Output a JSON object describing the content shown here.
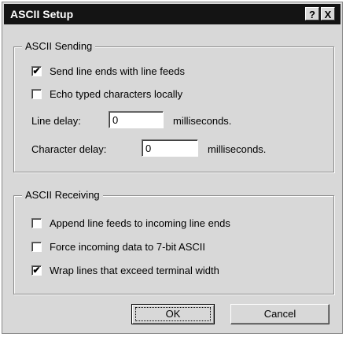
{
  "window": {
    "title": "ASCII Setup",
    "help_btn": "?",
    "close_btn": "X"
  },
  "sending": {
    "legend": "ASCII Sending",
    "send_line_ends": {
      "label": "Send line ends with line feeds",
      "checked": true
    },
    "echo_typed": {
      "label": "Echo typed characters locally",
      "checked": false
    },
    "line_delay": {
      "label": "Line delay:",
      "value": "0",
      "unit": "milliseconds."
    },
    "char_delay": {
      "label": "Character delay:",
      "value": "0",
      "unit": "milliseconds."
    }
  },
  "receiving": {
    "legend": "ASCII Receiving",
    "append_line_feeds": {
      "label": "Append line feeds to incoming line ends",
      "checked": false
    },
    "force_7bit": {
      "label": "Force incoming data to 7-bit ASCII",
      "checked": false
    },
    "wrap_lines": {
      "label": "Wrap lines that exceed terminal width",
      "checked": true
    }
  },
  "buttons": {
    "ok": "OK",
    "cancel": "Cancel"
  },
  "check_mark": "✔"
}
